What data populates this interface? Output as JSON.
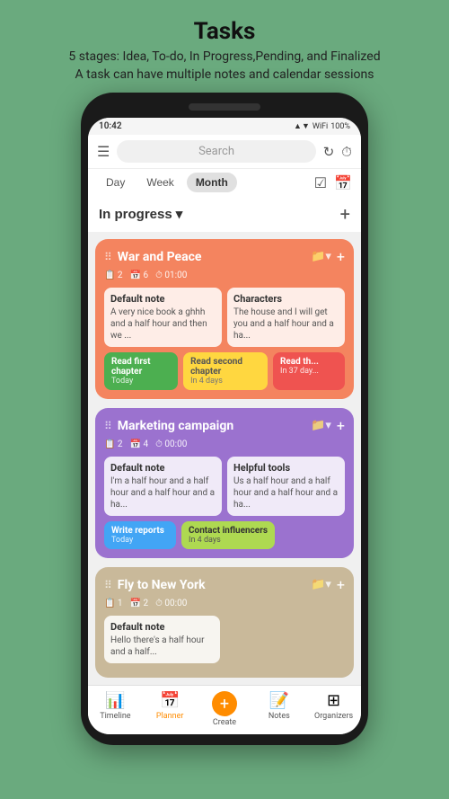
{
  "page": {
    "title": "Tasks",
    "subtitle_line1": "5 stages: Idea, To-do, In Progress,Pending, and Finalized",
    "subtitle_line2": "A task can have multiple notes and calendar sessions"
  },
  "status_bar": {
    "time": "10:42",
    "battery": "100%",
    "signal": "▲▼ ⓘ"
  },
  "app_bar": {
    "search_placeholder": "Search",
    "icon_refresh": "↻",
    "icon_timer": "⏱"
  },
  "tabs": [
    {
      "label": "Day",
      "active": false
    },
    {
      "label": "Week",
      "active": false
    },
    {
      "label": "Month",
      "active": true
    }
  ],
  "section": {
    "title": "In progress",
    "add_label": "+"
  },
  "tasks": [
    {
      "id": "war-and-peace",
      "title": "War and Peace",
      "meta": [
        {
          "icon": "📋",
          "value": "2"
        },
        {
          "icon": "📅",
          "value": "6"
        },
        {
          "icon": "⏱",
          "value": "01:00"
        }
      ],
      "color": "orange",
      "notes": [
        {
          "title": "Default note",
          "text": "A very nice book a ghhh and a half hour and then we ..."
        },
        {
          "title": "Characters",
          "text": "The house and I will get you and a half hour and a ha..."
        }
      ],
      "subtasks": [
        {
          "label": "Read first chapter",
          "date": "Today",
          "color": "green"
        },
        {
          "label": "Read second chapter",
          "date": "In 4 days",
          "color": "yellow"
        },
        {
          "label": "Read th...",
          "date": "In 37 day...",
          "color": "red"
        }
      ]
    },
    {
      "id": "marketing-campaign",
      "title": "Marketing campaign",
      "meta": [
        {
          "icon": "📋",
          "value": "2"
        },
        {
          "icon": "📅",
          "value": "4"
        },
        {
          "icon": "⏱",
          "value": "00:00"
        }
      ],
      "color": "purple",
      "notes": [
        {
          "title": "Default note",
          "text": "I'm a half hour and a half hour and a half hour and a ha..."
        },
        {
          "title": "Helpful tools",
          "text": "Us a half hour and a half hour and a half hour and a ha..."
        }
      ],
      "subtasks": [
        {
          "label": "Write reports",
          "date": "Today",
          "color": "blue"
        },
        {
          "label": "Contact influencers",
          "date": "In 4 days",
          "color": "lime"
        }
      ]
    },
    {
      "id": "fly-to-new-york",
      "title": "Fly to New York",
      "meta": [
        {
          "icon": "📋",
          "value": "1"
        },
        {
          "icon": "📅",
          "value": "2"
        },
        {
          "icon": "⏱",
          "value": "00:00"
        }
      ],
      "color": "tan",
      "notes": [
        {
          "title": "Default note",
          "text": "Hello there's a half hour and a half..."
        }
      ],
      "subtasks": []
    }
  ],
  "bottom_nav": [
    {
      "label": "Timeline",
      "icon": "📊",
      "active": false
    },
    {
      "label": "Planner",
      "icon": "📅",
      "active": true
    },
    {
      "label": "Create",
      "icon": "+",
      "active": false,
      "special": true
    },
    {
      "label": "Notes",
      "icon": "📝",
      "active": false
    },
    {
      "label": "Organizers",
      "icon": "⊞",
      "active": false
    }
  ]
}
